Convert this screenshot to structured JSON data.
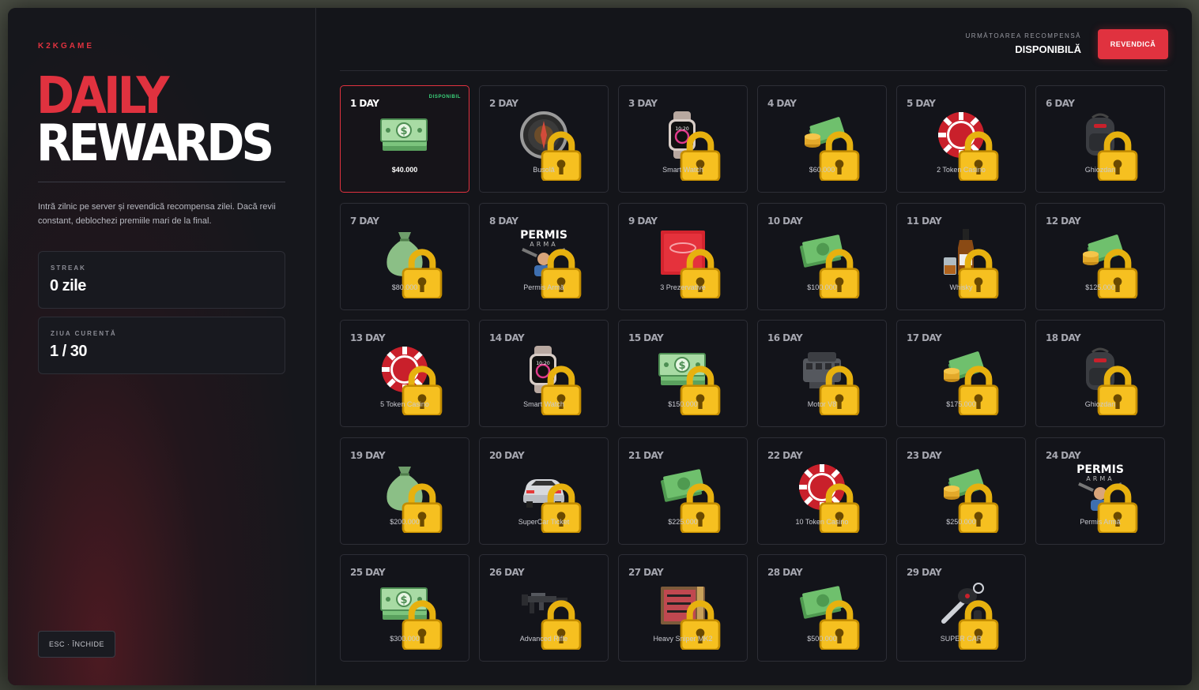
{
  "sidebar": {
    "brand": "K2KGAME",
    "title_line1": "DAILY",
    "title_line2": "REWARDS",
    "description": "Intră zilnic pe server și revendică recompensa zilei. Dacă revii constant, deblochezi premiile mari de la final.",
    "streak_label": "STREAK",
    "streak_value": "0 zile",
    "current_day_label": "ZIUA CURENTĂ",
    "current_day_value": "1 / 30",
    "close_button": "ESC · ÎNCHIDE"
  },
  "header": {
    "next_reward_label": "URMĂTOAREA RECOMPENSĂ",
    "next_reward_status": "DISPONIBILĂ",
    "claim_button": "REVENDICĂ"
  },
  "colors": {
    "accent": "#e0323f",
    "available": "#3ad27a",
    "lock": "#f2b400"
  },
  "rewards": [
    {
      "day": "1 DAY",
      "name": "$40.000",
      "icon": "cash-stack-icon",
      "status": "DISPONIBIL",
      "locked": false
    },
    {
      "day": "2 DAY",
      "name": "Busolă",
      "icon": "compass-icon",
      "locked": true
    },
    {
      "day": "3 DAY",
      "name": "Smart Watch",
      "icon": "smartwatch-icon",
      "locked": true
    },
    {
      "day": "4 DAY",
      "name": "$60.000",
      "icon": "cash-coins-icon",
      "locked": true
    },
    {
      "day": "5 DAY",
      "name": "2 Token Casino",
      "icon": "casino-chip-icon",
      "locked": true
    },
    {
      "day": "6 DAY",
      "name": "Ghiozdan",
      "icon": "backpack-icon",
      "locked": true
    },
    {
      "day": "7 DAY",
      "name": "$80.000",
      "icon": "money-bag-icon",
      "locked": true
    },
    {
      "day": "8 DAY",
      "name": "Permis Armă",
      "icon": "gun-license-icon",
      "locked": true
    },
    {
      "day": "9 DAY",
      "name": "3 Prezervative",
      "icon": "condom-pack-icon",
      "locked": true
    },
    {
      "day": "10 DAY",
      "name": "$100.000",
      "icon": "cash-bills-icon",
      "locked": true
    },
    {
      "day": "11 DAY",
      "name": "Whisky",
      "icon": "whisky-bottle-icon",
      "locked": true
    },
    {
      "day": "12 DAY",
      "name": "$125.000",
      "icon": "cash-coins-icon",
      "locked": true
    },
    {
      "day": "13 DAY",
      "name": "5 Token Casino",
      "icon": "casino-chip-icon",
      "locked": true
    },
    {
      "day": "14 DAY",
      "name": "Smart Watch",
      "icon": "smartwatch-icon",
      "locked": true
    },
    {
      "day": "15 DAY",
      "name": "$150.000",
      "icon": "cash-stack-icon",
      "locked": true
    },
    {
      "day": "16 DAY",
      "name": "Motor V8",
      "icon": "engine-icon",
      "locked": true
    },
    {
      "day": "17 DAY",
      "name": "$175.000",
      "icon": "cash-coins-icon",
      "locked": true
    },
    {
      "day": "18 DAY",
      "name": "Ghiozdan",
      "icon": "backpack-icon",
      "locked": true
    },
    {
      "day": "19 DAY",
      "name": "$200.000",
      "icon": "money-bag-icon",
      "locked": true
    },
    {
      "day": "20 DAY",
      "name": "SuperCar Ticket",
      "icon": "supercar-icon",
      "locked": true
    },
    {
      "day": "21 DAY",
      "name": "$225.000",
      "icon": "cash-bills-icon",
      "locked": true
    },
    {
      "day": "22 DAY",
      "name": "10 Token Casino",
      "icon": "casino-chip-icon",
      "locked": true
    },
    {
      "day": "23 DAY",
      "name": "$250.000",
      "icon": "cash-coins-icon",
      "locked": true
    },
    {
      "day": "24 DAY",
      "name": "Permis Armă",
      "icon": "gun-license-icon",
      "locked": true
    },
    {
      "day": "25 DAY",
      "name": "$300.000",
      "icon": "cash-stack-icon",
      "locked": true
    },
    {
      "day": "26 DAY",
      "name": "Advanced Rifle",
      "icon": "rifle-icon",
      "locked": true
    },
    {
      "day": "27 DAY",
      "name": "Heavy Sniper MK2",
      "icon": "weapon-case-icon",
      "locked": true
    },
    {
      "day": "28 DAY",
      "name": "$500.000",
      "icon": "cash-bills-icon",
      "locked": true
    },
    {
      "day": "29 DAY",
      "name": "SUPER CAR",
      "icon": "car-key-icon",
      "locked": true
    }
  ]
}
